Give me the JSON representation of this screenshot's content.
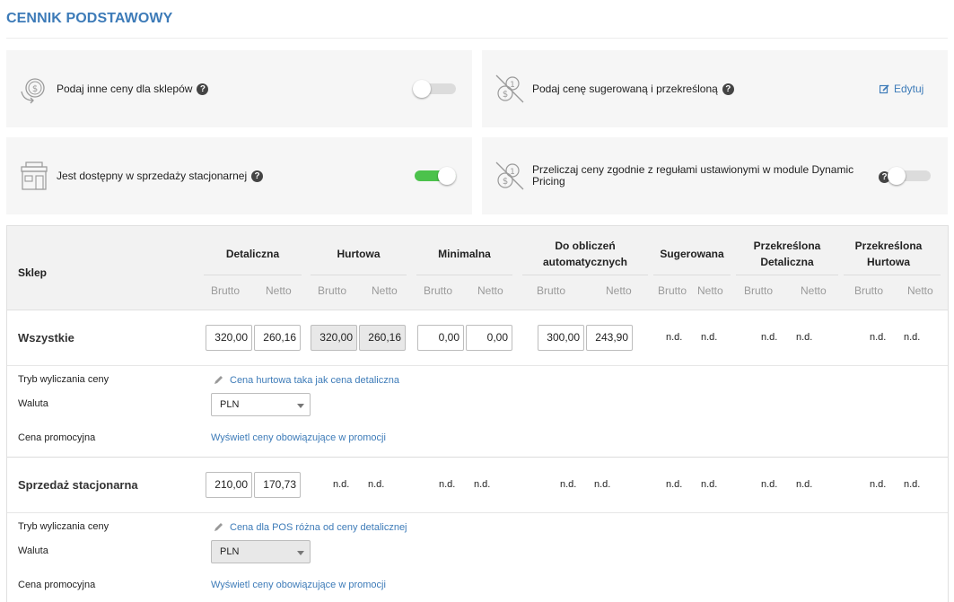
{
  "page": {
    "title": "CENNIK PODSTAWOWY"
  },
  "cards": {
    "other_prices": {
      "label": "Podaj inne ceny dla sklepów",
      "toggle_on": false
    },
    "suggested": {
      "label": "Podaj cenę sugerowaną i przekreśloną",
      "edit_label": "Edytuj"
    },
    "stationary": {
      "label": "Jest dostępny w sprzedaży stacjonarnej",
      "toggle_on": true
    },
    "dynamic": {
      "label": "Przeliczaj ceny zgodnie z regułami ustawionymi w module Dynamic Pricing",
      "toggle_on": false
    }
  },
  "table": {
    "header": {
      "shop": "Sklep",
      "groups": [
        "Detaliczna",
        "Hurtowa",
        "Minimalna",
        "Do obliczeń automatycznych",
        "Sugerowana",
        "Przekreślona Detaliczna",
        "Przekreślona Hurtowa"
      ],
      "gross": "Brutto",
      "net": "Netto"
    },
    "rows": [
      {
        "name": "Wszystkie",
        "retail": [
          "320,00",
          "260,16"
        ],
        "wholesale": [
          "320,00",
          "260,16"
        ],
        "minimal": [
          "0,00",
          "0,00"
        ],
        "auto": [
          "300,00",
          "243,90"
        ],
        "suggested": [
          "n.d.",
          "n.d."
        ],
        "crossed_retail": [
          "n.d.",
          "n.d."
        ],
        "crossed_wholesale": [
          "n.d.",
          "n.d."
        ],
        "mode_label": "Tryb wyliczania ceny",
        "mode_value": "Cena hurtowa taka jak cena detaliczna",
        "currency_label": "Waluta",
        "currency_value": "PLN",
        "promo_label": "Cena promocyjna",
        "promo_link": "Wyświetl ceny obowiązujące w promocji"
      },
      {
        "name": "Sprzedaż stacjonarna",
        "retail": [
          "210,00",
          "170,73"
        ],
        "wholesale": [
          "n.d.",
          "n.d."
        ],
        "minimal": [
          "n.d.",
          "n.d."
        ],
        "auto": [
          "n.d.",
          "n.d."
        ],
        "suggested": [
          "n.d.",
          "n.d."
        ],
        "crossed_retail": [
          "n.d.",
          "n.d."
        ],
        "crossed_wholesale": [
          "n.d.",
          "n.d."
        ],
        "mode_label": "Tryb wyliczania ceny",
        "mode_value": "Cena dla POS różna od ceny detalicznej",
        "currency_label": "Waluta",
        "currency_value": "PLN",
        "promo_label": "Cena promocyjna",
        "promo_link": "Wyświetl ceny obowiązujące w promocji"
      }
    ]
  },
  "colors": {
    "accent": "#3d7bb8",
    "toggle_on": "#4cc24c",
    "card_bg": "#f6f6f6",
    "header_bg": "#f2f2f2"
  },
  "icons": [
    "coin-cycle-icon",
    "crossed-coins-icon",
    "store-icon",
    "help-icon",
    "edit-icon",
    "pencil-icon",
    "chevron-down-icon"
  ]
}
